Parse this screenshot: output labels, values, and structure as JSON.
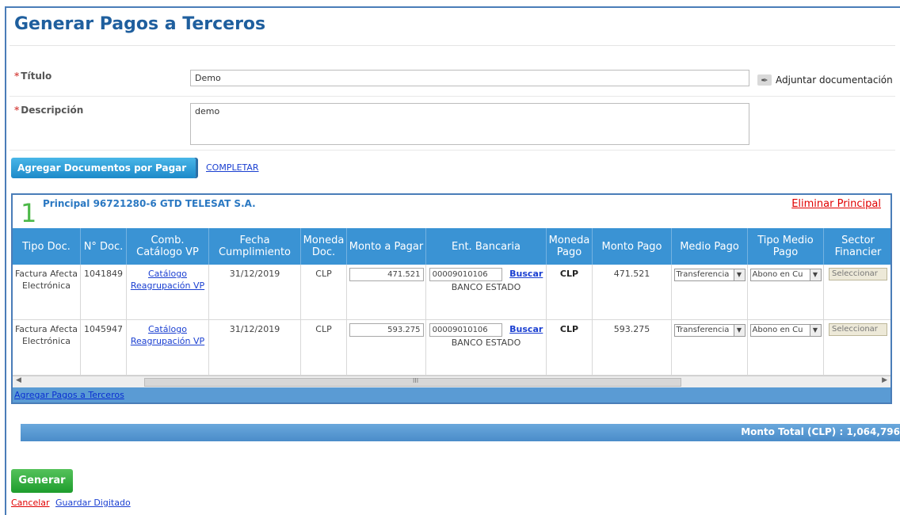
{
  "page": {
    "title": "Generar Pagos a Terceros"
  },
  "form": {
    "titulo_label": "Título",
    "titulo_value": "Demo",
    "descripcion_label": "Descripción",
    "descripcion_value": "demo",
    "required_mark": "*",
    "attach_label": "Adjuntar documentación",
    "attach_icon": "paperclip-icon"
  },
  "actions": {
    "add_docs_label": "Agregar Documentos por Pagar",
    "completar_label": "COMPLETAR"
  },
  "panel": {
    "number": "1",
    "title": "Principal 96721280-6 GTD TELESAT S.A.",
    "delete_label": "Eliminar Principal",
    "footer_link": "Agregar Pagos a Terceros",
    "columns": [
      "Tipo Doc.",
      "N° Doc.",
      "Comb. Catálogo VP",
      "Fecha Cumplimiento",
      "Moneda Doc.",
      "Monto a Pagar",
      "Ent. Bancaria",
      "Moneda Pago",
      "Monto Pago",
      "Medio Pago",
      "Tipo Medio Pago",
      "Sector Financier"
    ],
    "rows": [
      {
        "tipo_doc": "Factura Afecta Electrónica",
        "n_doc": "1041849",
        "catalogo_link": "Catálogo Reagrupación VP",
        "fecha": "31/12/2019",
        "moneda_doc": "CLP",
        "monto_pagar": "471.521",
        "ent_codigo": "00009010106",
        "ent_buscar": "Buscar",
        "ent_banco": "BANCO ESTADO",
        "moneda_pago": "CLP",
        "monto_pago": "471.521",
        "medio_pago": "Transferencia",
        "tipo_medio_pago": "Abono en Cu",
        "sector": "Seleccionar"
      },
      {
        "tipo_doc": "Factura Afecta Electrónica",
        "n_doc": "1045947",
        "catalogo_link": "Catálogo Reagrupación VP",
        "fecha": "31/12/2019",
        "moneda_doc": "CLP",
        "monto_pagar": "593.275",
        "ent_codigo": "00009010106",
        "ent_buscar": "Buscar",
        "ent_banco": "BANCO ESTADO",
        "moneda_pago": "CLP",
        "monto_pago": "593.275",
        "medio_pago": "Transferencia",
        "tipo_medio_pago": "Abono en Cu",
        "sector": "Seleccionar"
      }
    ],
    "scroll_glyph": "III"
  },
  "total": {
    "label": "Monto Total (CLP) : 1,064,796"
  },
  "footer": {
    "generar_label": "Generar",
    "cancelar_label": "Cancelar",
    "guardar_label": "Guardar Digitado"
  },
  "colors": {
    "accent": "#1f5f9e",
    "header_blue": "#3a93d4",
    "green": "#4cb848",
    "danger": "#e00000"
  }
}
